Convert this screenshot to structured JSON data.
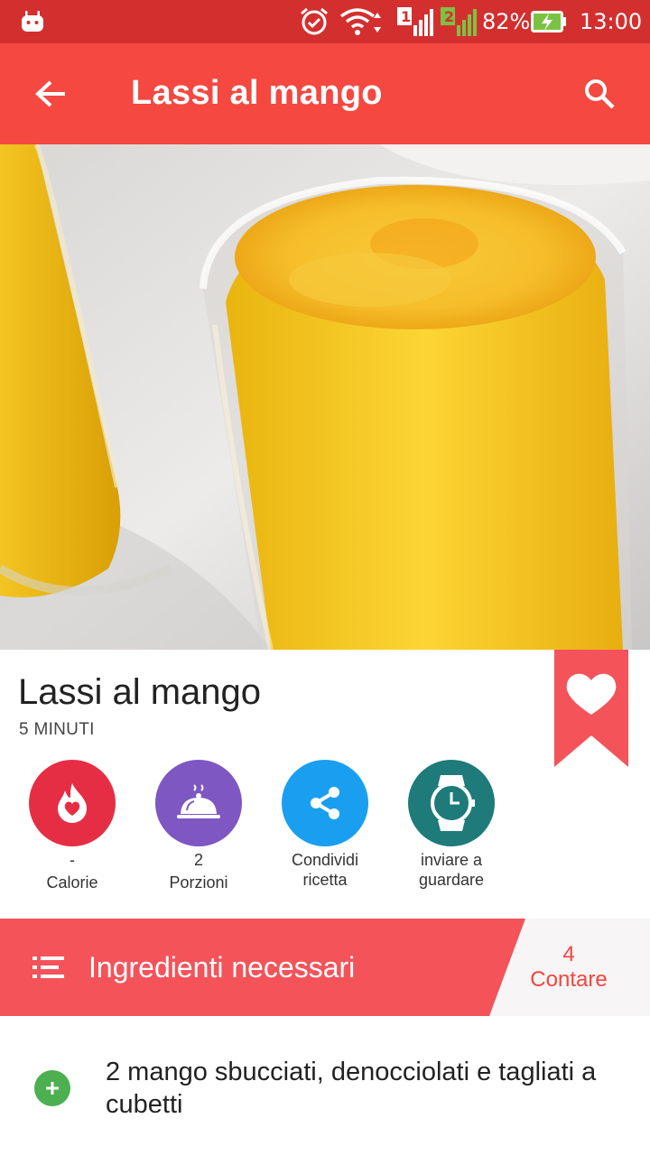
{
  "status_bar": {
    "battery": "82%",
    "time": "13:00",
    "sim1": "1",
    "sim2": "2"
  },
  "app_bar": {
    "title": "Lassi al mango",
    "back_icon": "arrow-back-icon",
    "search_icon": "search-icon"
  },
  "recipe": {
    "title": "Lassi al mango",
    "time": "5 MINUTI",
    "favorite_icon": "heart-bookmark-icon"
  },
  "actions": [
    {
      "icon": "flame-heart-icon",
      "line1": "-",
      "line2": "Calorie",
      "color": "#e52e44"
    },
    {
      "icon": "serving-dish-icon",
      "line1": "2",
      "line2": "Porzioni",
      "color": "#7e57c2"
    },
    {
      "icon": "share-icon",
      "line1": "Condividi",
      "line2": "ricetta",
      "color": "#1a9ff0"
    },
    {
      "icon": "watch-icon",
      "line1": "inviare a",
      "line2": "guardare",
      "color": "#1f7a7a"
    }
  ],
  "ingredients": {
    "title": "Ingredienti necessari",
    "count_value": "4",
    "count_label": "Contare",
    "items": [
      {
        "text": "2 mango sbucciati, denocciolati e tagliati a cubetti"
      }
    ]
  },
  "colors": {
    "status_bar": "#d32f2f",
    "app_bar": "#f44840",
    "accent_red": "#f4535a",
    "plus_green": "#4caf50"
  }
}
